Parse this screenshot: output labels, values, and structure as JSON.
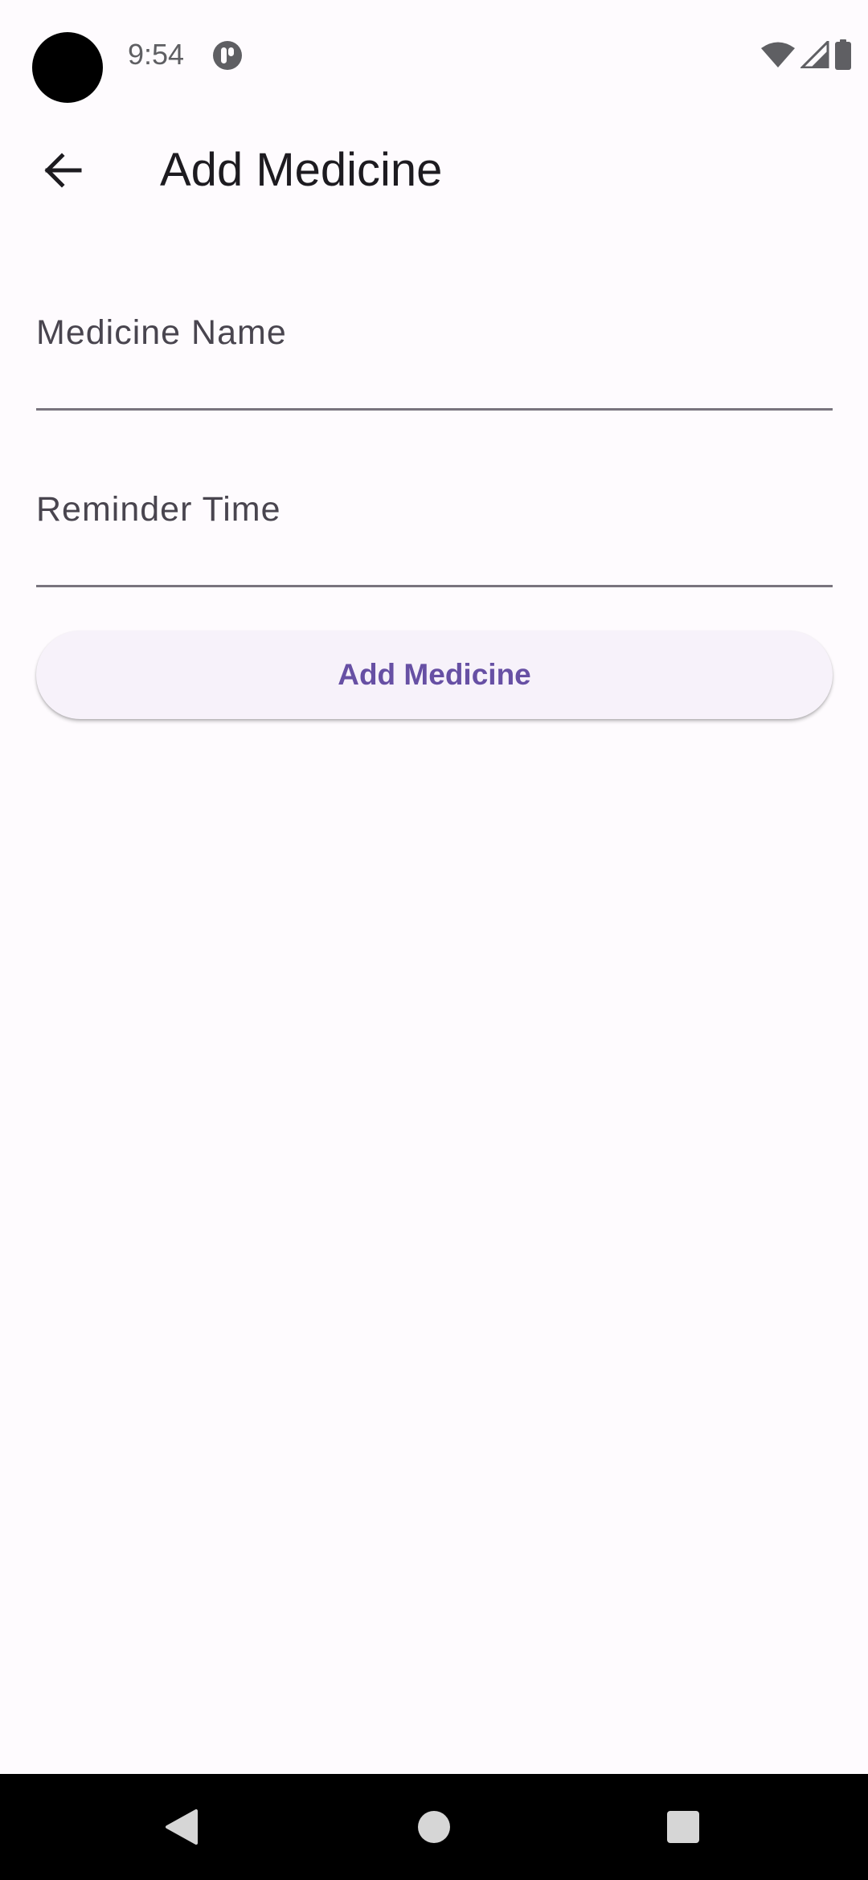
{
  "status_bar": {
    "time": "9:54",
    "icons": [
      "camera-cutout",
      "app-notification-icon",
      "wifi-icon",
      "cell-signal-icon",
      "battery-icon"
    ]
  },
  "app_bar": {
    "back_icon": "arrow-back-icon",
    "title": "Add Medicine"
  },
  "form": {
    "medicine_name": {
      "label": "Medicine Name",
      "value": ""
    },
    "reminder_time": {
      "label": "Reminder Time",
      "value": ""
    },
    "submit_label": "Add Medicine"
  },
  "nav_bar": {
    "icons": [
      "nav-back-icon",
      "nav-home-icon",
      "nav-recents-icon"
    ]
  },
  "colors": {
    "background": "#fefbfe",
    "primary": "#6750a4",
    "button_surface": "#f7f2fa",
    "text": "#1d1b20",
    "label": "#49454f",
    "underline": "#79747e"
  }
}
